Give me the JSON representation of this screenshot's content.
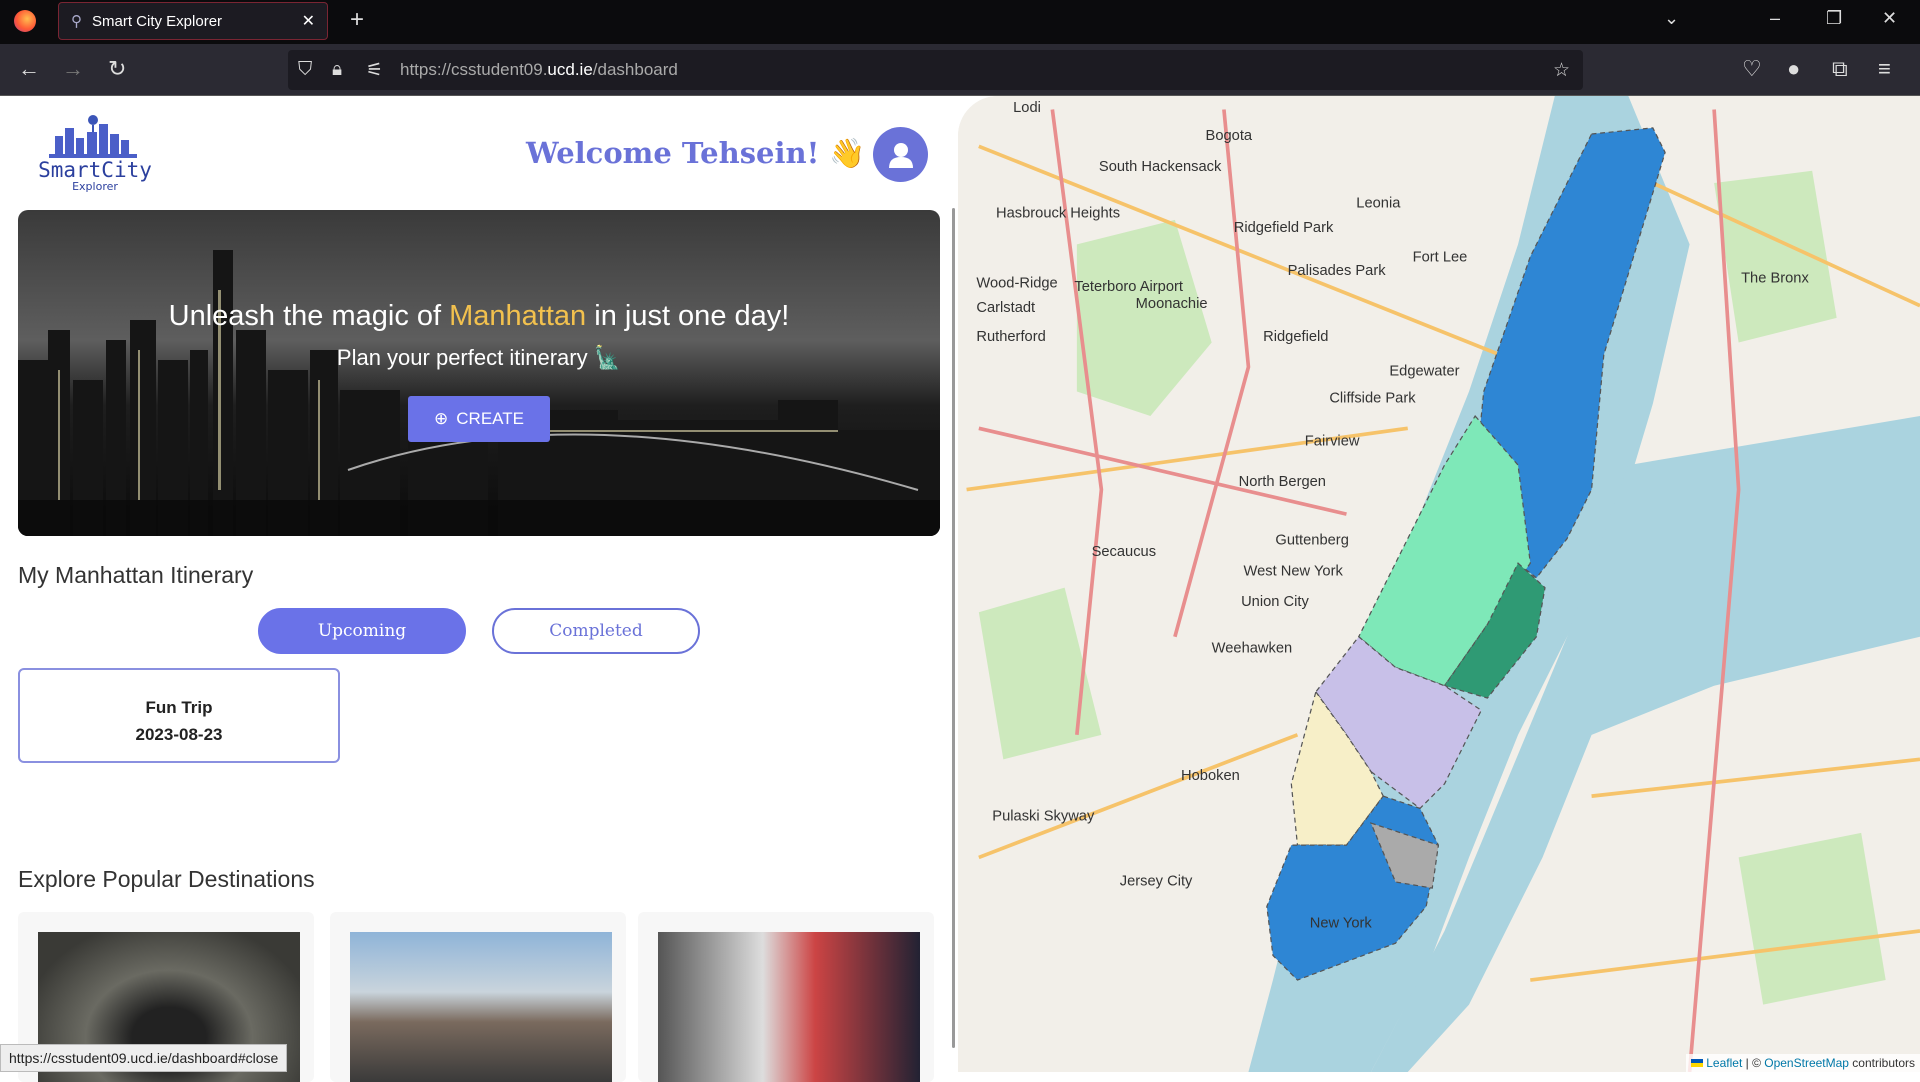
{
  "browser": {
    "tab_title": "Smart City Explorer",
    "url_prefix": "https://csstudent09.",
    "url_domain": "ucd.ie",
    "url_path": "/dashboard",
    "status_url": "https://csstudent09.ucd.ie/dashboard#close"
  },
  "header": {
    "logo_text": "SmartCity Explorer",
    "welcome": "Welcome Tehsein! 👋"
  },
  "hero": {
    "headline_pre": "Unleash the magic of ",
    "headline_highlight": "Manhattan",
    "headline_post": " in just one day!",
    "subline": "Plan your perfect itinerary 🗽",
    "create_label": "CREATE"
  },
  "itinerary": {
    "title": "My Manhattan Itinerary",
    "tabs": [
      {
        "label": "Upcoming",
        "active": true
      },
      {
        "label": "Completed",
        "active": false
      }
    ],
    "trips": [
      {
        "name": "Fun Trip",
        "date": "2023-08-23"
      }
    ]
  },
  "explore": {
    "title": "Explore Popular Destinations"
  },
  "map": {
    "attribution_leaflet": "Leaflet",
    "attribution_sep": " | © ",
    "attribution_osm": "OpenStreetMap",
    "attribution_post": " contributors",
    "labels": [
      "Lodi",
      "Bogota",
      "South Hackensack",
      "Hasbrouck Heights",
      "Ridgefield Park",
      "Leonia",
      "Fort Lee",
      "Palisades Park",
      "Wood-Ridge",
      "Carlstadt",
      "Teterboro Airport",
      "Moonachie",
      "Ridgefield",
      "Rutherford",
      "Edgewater",
      "Cliffside Park",
      "Fairview",
      "North Bergen",
      "Secaucus",
      "Guttenberg",
      "West New York",
      "Union City",
      "Weehawken",
      "Hoboken",
      "Jersey City",
      "Pulaski Skyway",
      "The Bronx",
      "New York"
    ]
  },
  "colors": {
    "accent": "#6a72e8",
    "title": "#6a72d8",
    "highlight": "#f2c14e"
  }
}
